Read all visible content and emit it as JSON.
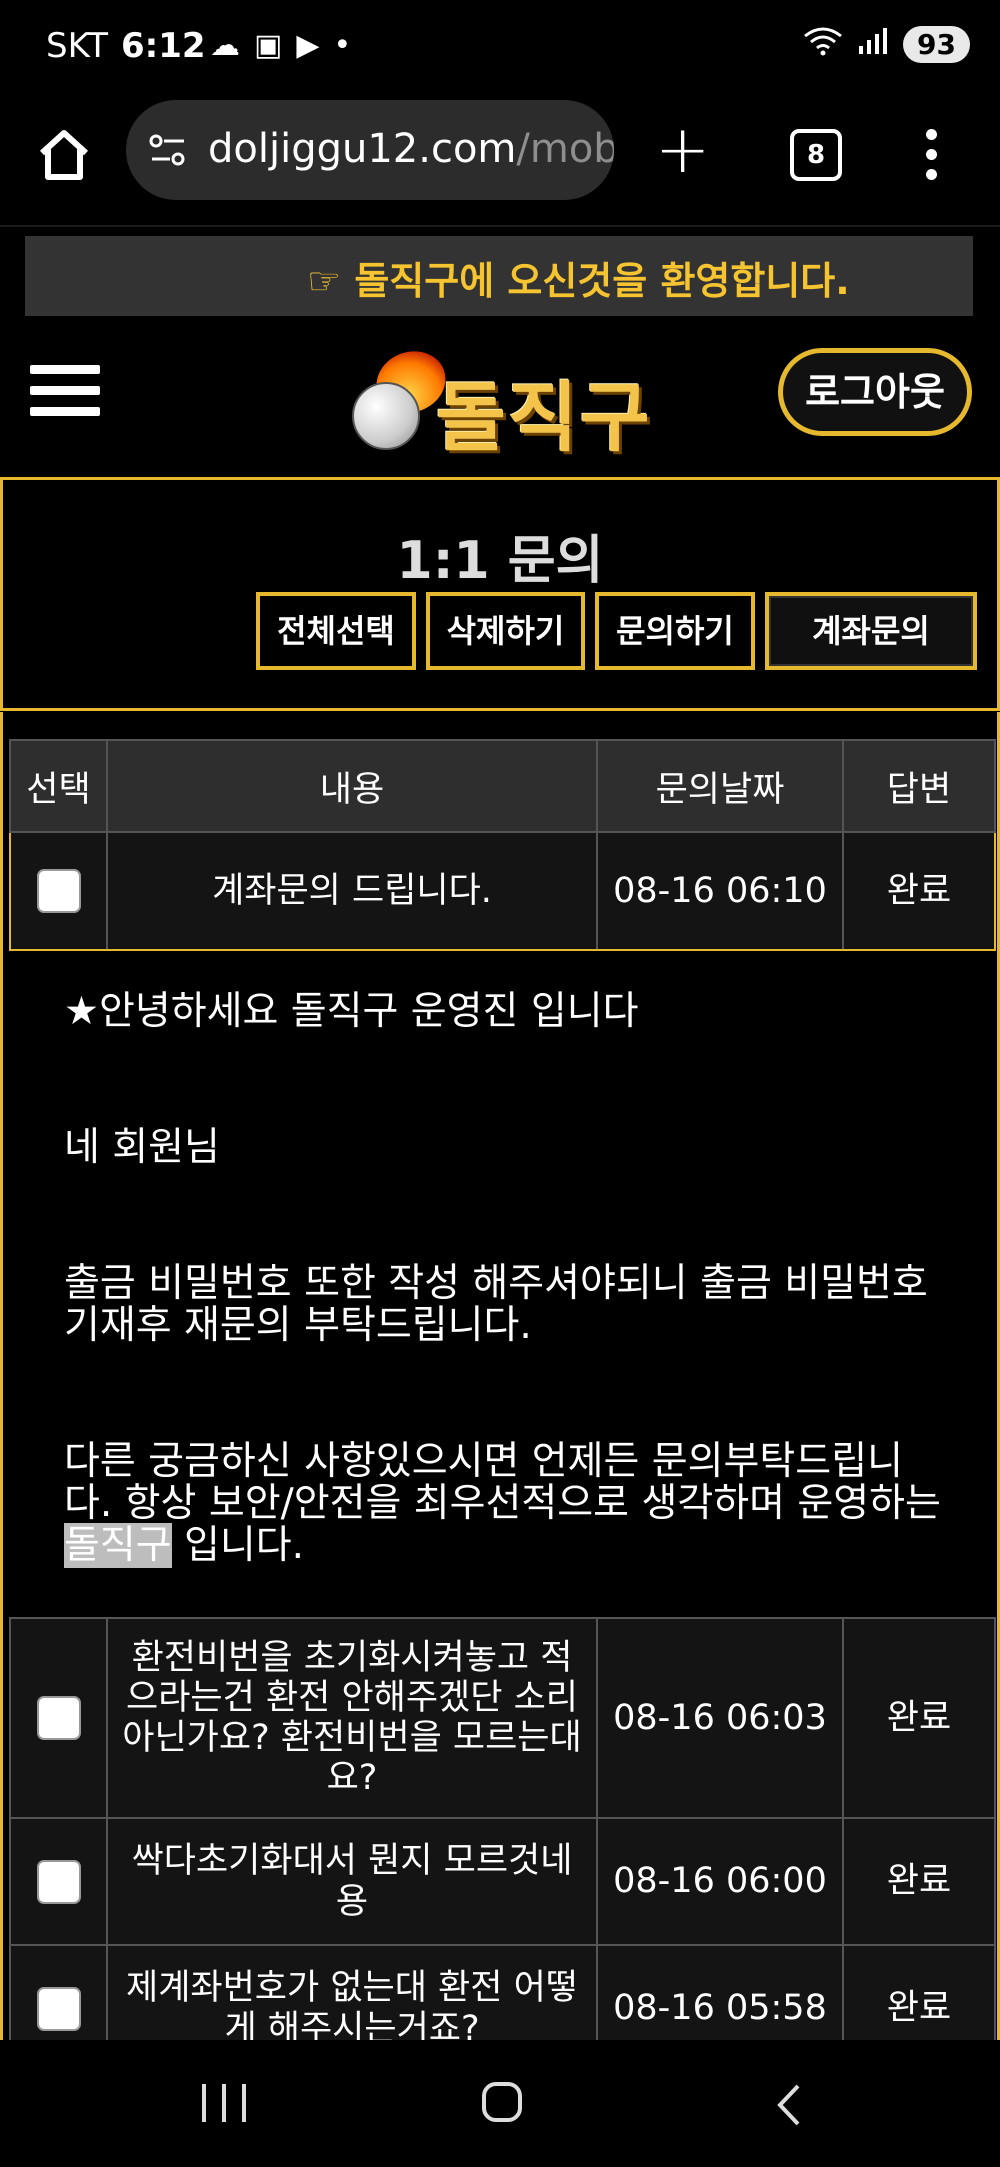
{
  "status_bar": {
    "carrier": "SKT",
    "time": "6:12",
    "battery": "93"
  },
  "browser": {
    "url_host": "doljiggu12.com",
    "url_path": "/mobi",
    "tab_count": "8"
  },
  "welcome": {
    "icon": "☞",
    "text": "돌직구에 오신것을 환영합니다."
  },
  "header": {
    "logo_text": "돌직구",
    "logout_label": "로그아웃"
  },
  "inquiry": {
    "title": "1:1 문의",
    "buttons": {
      "select_all": "전체선택",
      "delete": "삭제하기",
      "inquire": "문의하기",
      "account_inquiry": "계좌문의"
    }
  },
  "table": {
    "headers": [
      "선택",
      "내용",
      "문의날짜",
      "답변"
    ],
    "rows": [
      {
        "subject": "계좌문의 드립니다.",
        "date": "08-16 06:10",
        "status": "완료"
      },
      {
        "subject": "환전비번을 초기화시켜놓고 적으라는건 환전 안해주겠단 소리아닌가요? 환전비번을 모르는대요?",
        "date": "08-16 06:03",
        "status": "완료"
      },
      {
        "subject": "싹다초기화대서 뭔지 모르것네용",
        "date": "08-16 06:00",
        "status": "완료"
      },
      {
        "subject": "제계좌번호가 없는대 환전 어떻게 해주시는거죠?",
        "date": "08-16 05:58",
        "status": "완료"
      }
    ],
    "reply": {
      "line1": "★안녕하세요 돌직구 운영진 입니다",
      "line2": "네 회원님",
      "line3": "출금 비밀번호 또한 작성 해주셔야되니 출금 비밀번호 기재후 재문의 부탁드립니다.",
      "line4_pre": "다른 궁금하신 사항있으시면 언제든 문의부탁드립니다. 항상 보안/안전을 최우선적으로 생각하며 운영하는 ",
      "line4_highlight": "돌직구",
      "line4_post": " 입니다."
    }
  }
}
